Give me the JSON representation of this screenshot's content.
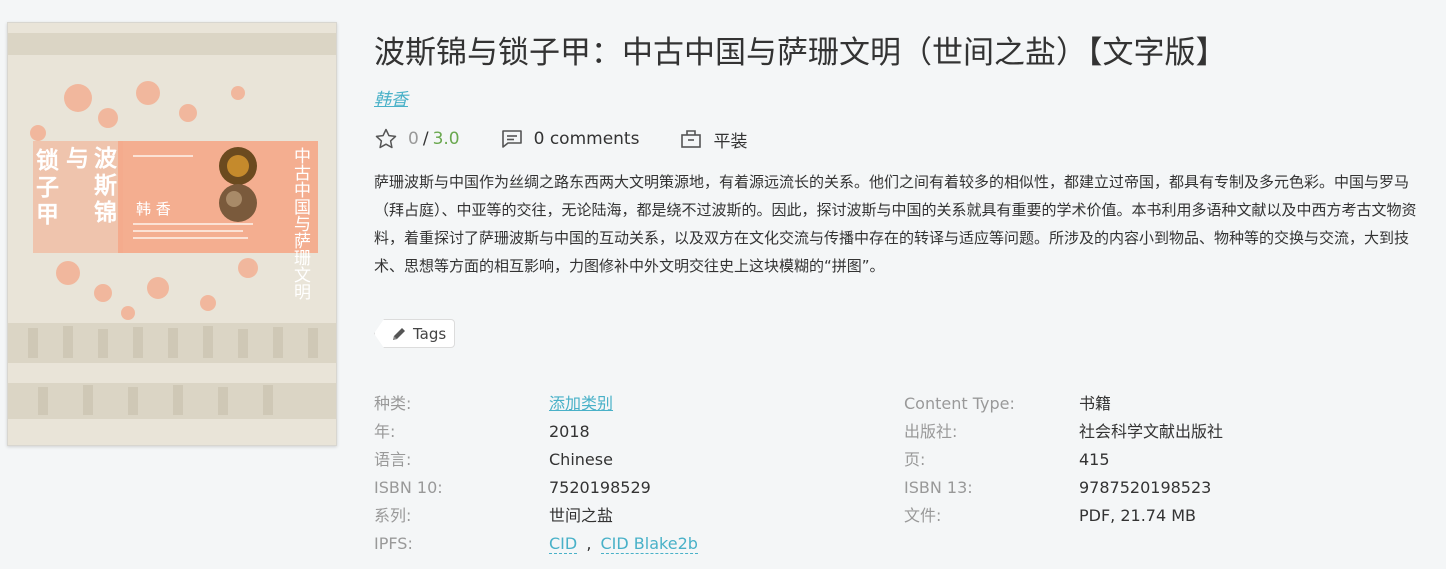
{
  "book": {
    "title": "波斯锦与锁子甲：中古中国与萨珊文明（世间之盐）【文字版】",
    "author": "韩香",
    "rating": {
      "value": "0",
      "separator": "/",
      "max": "3.0"
    },
    "comments": "0 comments",
    "format": "平装",
    "description": "萨珊波斯与中国作为丝绸之路东西两大文明策源地，有着源远流长的关系。他们之间有着较多的相似性，都建立过帝国，都具有专制及多元色彩。中国与罗马（拜占庭）、中亚等的交往，无论陆海，都是绕不过波斯的。因此，探讨波斯与中国的关系就具有重要的学术价值。本书利用多语种文献以及中西方考古文物资料，着重探讨了萨珊波斯与中国的互动关系，以及双方在文化交流与传播中存在的转译与适应等问题。所涉及的内容小到物品、物种等的交换与交流，大到技术、思想等方面的相互影响，力图修补中外文明交往史上这块模糊的“拼图”。",
    "tags_label": "Tags"
  },
  "cover": {
    "title_vertical_1": "波斯锦",
    "title_vertical_2": "与",
    "title_vertical_3": "锁子甲",
    "subtitle_vertical": "中古中国与萨珊文明",
    "author": "韩 香"
  },
  "properties": {
    "category_label": "种类:",
    "category_value": "添加类别",
    "content_type_label": "Content Type:",
    "content_type_value": "书籍",
    "year_label": "年:",
    "year_value": "2018",
    "publisher_label": "出版社:",
    "publisher_value": "社会科学文献出版社",
    "language_label": "语言:",
    "language_value": "Chinese",
    "pages_label": "页:",
    "pages_value": "415",
    "isbn10_label": "ISBN 10:",
    "isbn10_value": "7520198529",
    "isbn13_label": "ISBN 13:",
    "isbn13_value": "9787520198523",
    "series_label": "系列:",
    "series_value": "世间之盐",
    "file_label": "文件:",
    "file_value": "PDF, 21.74 MB",
    "ipfs_label": "IPFS:",
    "ipfs_cid": "CID",
    "ipfs_sep": ",",
    "ipfs_blake": "CID Blake2b"
  },
  "colors": {
    "accent": "#49b1c8",
    "rating_max": "#6aa84f",
    "cover_orange": "#f4a98a"
  }
}
